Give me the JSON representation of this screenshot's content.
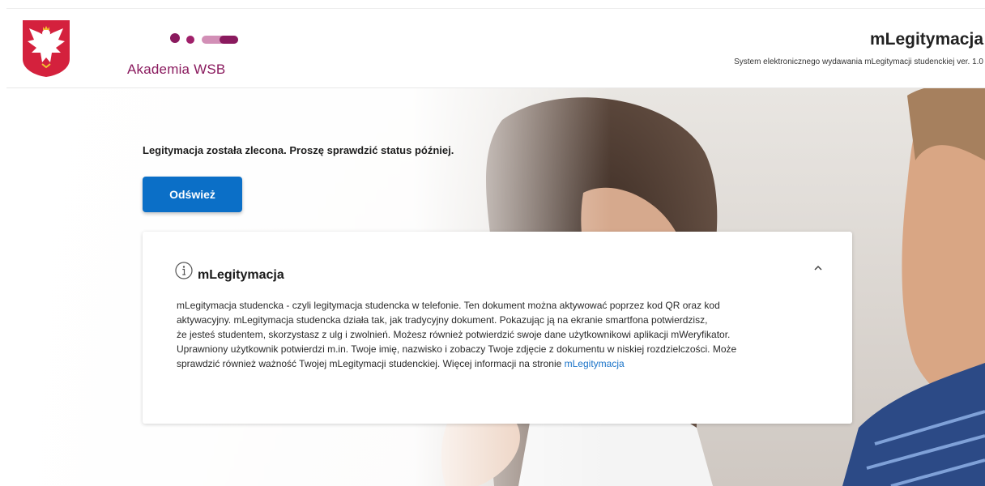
{
  "header": {
    "university_name": "Akademia WSB",
    "app_title": "mLegitymacja",
    "app_subtitle": "System elektronicznego wydawania mLegitymacji studenckiej ver. 1.0"
  },
  "main": {
    "status_message": "Legitymacja została zlecona. Proszę sprawdzić status później.",
    "refresh_label": "Odśwież"
  },
  "info_card": {
    "title": "mLegitymacja",
    "lines": [
      "mLegitymacja studencka - czyli legitymacja studencka w telefonie. Ten dokument można aktywować poprzez kod QR oraz kod",
      "aktywacyjny. mLegitymacja studencka działa tak, jak tradycyjny dokument. Pokazując ją na ekranie smartfona potwierdzisz,",
      "że jesteś studentem, skorzystasz z ulg i zwolnień. Możesz również potwierdzić swoje dane użytkownikowi aplikacji mWeryfikator.",
      "Uprawniony użytkownik potwierdzi m.in. Twoje imię, nazwisko i zobaczy Twoje zdjęcie z dokumentu w niskiej rozdzielczości. Może"
    ],
    "last_line_prefix": "sprawdzić również ważność Twojej mLegitymacji studenckiej. Więcej informacji na stronie ",
    "link_label": "mLegitymacja",
    "icons": {
      "info": "info-circle-icon",
      "collapse": "chevron-up-icon"
    }
  },
  "colors": {
    "primary_button": "#0b6fc7",
    "brand": "#8a1a5e",
    "link": "#1a73c8",
    "emblem_red": "#d4213d"
  }
}
